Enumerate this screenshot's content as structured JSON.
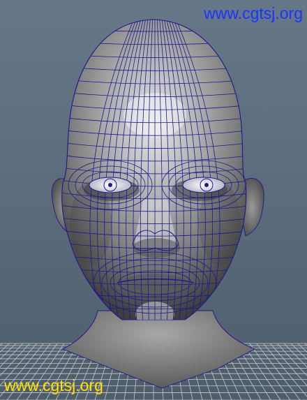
{
  "watermark_top": {
    "text": "www.cgtsj.org",
    "color": "#1a33ff"
  },
  "watermark_bottom": {
    "text": "www.cgtsj.org",
    "color": "#ffe000"
  },
  "viewport": {
    "background_color": "#5f6f80",
    "grid_color": "#c8c8c8",
    "wireframe_color": "#1c1a8c",
    "model_shading": "gray-smooth-with-wireframe",
    "model_icon": "human-head-mesh"
  }
}
